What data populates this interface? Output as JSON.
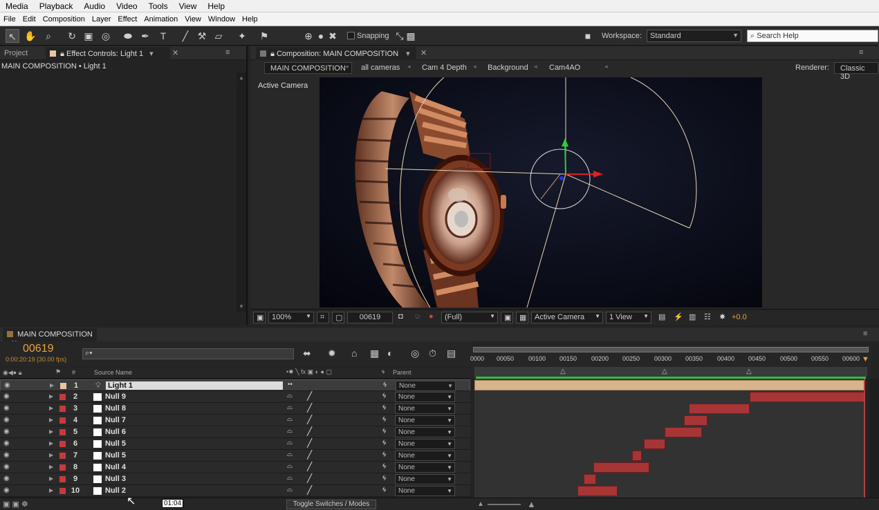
{
  "os_menu": [
    "Media",
    "Playback",
    "Audio",
    "Video",
    "Tools",
    "View",
    "Help"
  ],
  "app_menu": [
    "File",
    "Edit",
    "Composition",
    "Layer",
    "Effect",
    "Animation",
    "View",
    "Window",
    "Help"
  ],
  "toolbar": {
    "snapping_label": "Snapping",
    "workspace_label": "Workspace:",
    "workspace_value": "Standard",
    "search_placeholder": "Search Help"
  },
  "left_panel": {
    "tab_project": "Project",
    "tab_effect_controls": "Effect Controls: Light 1",
    "breadcrumb": "MAIN COMPOSITION • Light 1"
  },
  "comp_panel": {
    "tab_label": "Composition: MAIN COMPOSITION",
    "crumbs": [
      "MAIN COMPOSITION",
      "all cameras",
      "Cam 4 Depth",
      "Background",
      "Cam4AO"
    ],
    "renderer_label": "Renderer:",
    "renderer_value": "Classic 3D",
    "active_camera_label": "Active Camera"
  },
  "viewer_footer": {
    "zoom": "100%",
    "timecode": "00619",
    "resolution": "(Full)",
    "view": "Active Camera",
    "views_count": "1 View",
    "exposure": "+0.0"
  },
  "timeline": {
    "tab_label": "MAIN COMPOSITION",
    "current_frame": "00619",
    "timecode_fps": "0:00:20:19 (30.00 fps)",
    "search_placeholder": "⌕▾",
    "col_hash": "#",
    "col_source_name": "Source Name",
    "col_parent": "Parent",
    "ruler_ticks": [
      "0000",
      "00050",
      "00100",
      "00150",
      "00200",
      "00250",
      "00300",
      "00350",
      "00400",
      "00450",
      "00500",
      "00550",
      "00600"
    ],
    "layers": [
      {
        "num": "1",
        "name": "Light 1",
        "parent": "None"
      },
      {
        "num": "2",
        "name": "Null 9",
        "parent": "None"
      },
      {
        "num": "3",
        "name": "Null 8",
        "parent": "None"
      },
      {
        "num": "4",
        "name": "Null 7",
        "parent": "None"
      },
      {
        "num": "5",
        "name": "Null 6",
        "parent": "None"
      },
      {
        "num": "6",
        "name": "Null 5",
        "parent": "None"
      },
      {
        "num": "7",
        "name": "Null 5",
        "parent": "None"
      },
      {
        "num": "8",
        "name": "Null 4",
        "parent": "None"
      },
      {
        "num": "9",
        "name": "Null 3",
        "parent": "None"
      },
      {
        "num": "10",
        "name": "Null 2",
        "parent": "None"
      }
    ],
    "toggle_label": "Toggle Switches / Modes",
    "tooltip": "01:04"
  },
  "colors": {
    "accent_orange": "#e8a33d",
    "label_red": "#c83a3a",
    "light_label": "#e8c6a0",
    "light_bar": "#d9b38c",
    "bar_red": "#a83535",
    "work_area_green": "#2fbf3b"
  }
}
